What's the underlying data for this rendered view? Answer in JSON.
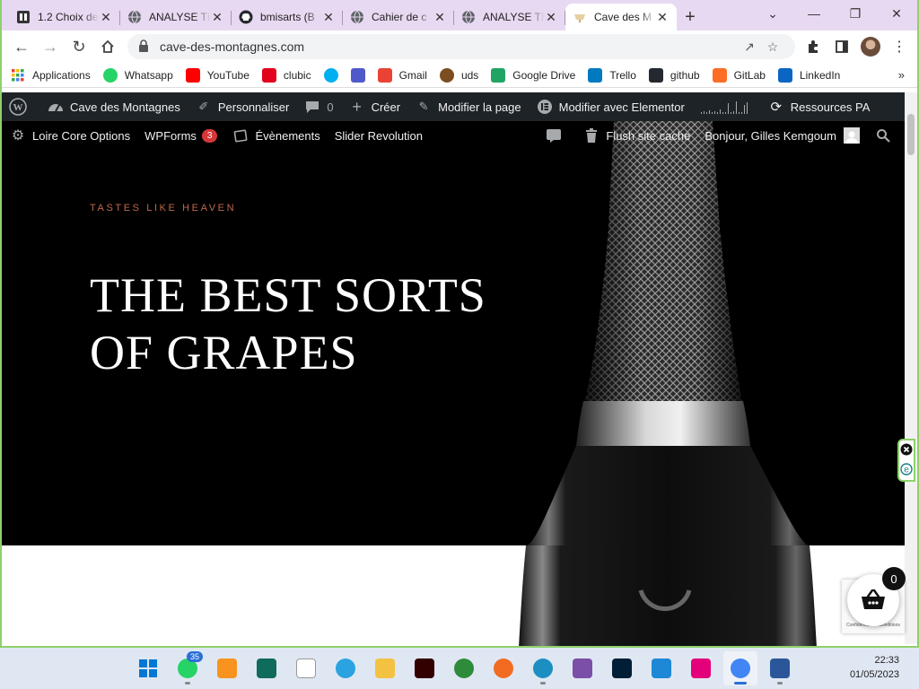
{
  "browser": {
    "tabs": [
      {
        "title": "1.2 Choix de",
        "icon": "document-icon",
        "active": false
      },
      {
        "title": "ANALYSE TE",
        "icon": "globe-icon",
        "active": false
      },
      {
        "title": "bmisarts (B",
        "icon": "github-icon",
        "active": false
      },
      {
        "title": "Cahier de c",
        "icon": "globe-icon",
        "active": false
      },
      {
        "title": "ANALYSE TE",
        "icon": "globe-icon",
        "active": false
      },
      {
        "title": "Cave des M",
        "icon": "wine-icon",
        "active": true
      }
    ],
    "new_tab": "+",
    "url": "cave-des-montagnes.com",
    "bookmarks": [
      {
        "label": "Applications",
        "icon": "apps-grid-icon",
        "color": "#ea4335"
      },
      {
        "label": "Whatsapp",
        "icon": "whatsapp-icon",
        "color": "#25d366"
      },
      {
        "label": "YouTube",
        "icon": "youtube-icon",
        "color": "#ff0000"
      },
      {
        "label": "clubic",
        "icon": "clubic-icon",
        "color": "#e3001b"
      },
      {
        "label": "",
        "icon": "skype-icon",
        "color": "#00aff0"
      },
      {
        "label": "",
        "icon": "teams-icon",
        "color": "#5059c9"
      },
      {
        "label": "Gmail",
        "icon": "gmail-icon",
        "color": "#ea4335"
      },
      {
        "label": "uds",
        "icon": "uds-icon",
        "color": "#7b4d1f"
      },
      {
        "label": "Google Drive",
        "icon": "google-drive-icon",
        "color": "#1fa463"
      },
      {
        "label": "Trello",
        "icon": "trello-icon",
        "color": "#0079bf"
      },
      {
        "label": "github",
        "icon": "github-icon",
        "color": "#24292f"
      },
      {
        "label": "GitLab",
        "icon": "gitlab-icon",
        "color": "#fc6d26"
      },
      {
        "label": "LinkedIn",
        "icon": "linkedin-icon",
        "color": "#0a66c2"
      }
    ],
    "more_bookmarks": "»"
  },
  "adminbar": {
    "site_name": "Cave des Montagnes",
    "customize": "Personnaliser",
    "comments": "0",
    "create": "Créer",
    "edit_page": "Modifier la page",
    "edit_elementor": "Modifier avec Elementor",
    "resources": "Ressources PA"
  },
  "subbar": {
    "loire_core": "Loire Core Options",
    "wpforms": "WPForms",
    "wpforms_badge": "3",
    "events": "Évènements",
    "slider": "Slider Revolution",
    "flush": "Flush site cache",
    "greeting": "Bonjour, Gilles Kemgoum"
  },
  "hero": {
    "kicker": "TASTES LIKE HEAVEN",
    "headline_line1": "THE BEST SORTS",
    "headline_line2": "OF GRAPES"
  },
  "cart": {
    "count": "0"
  },
  "recaptcha": {
    "text": "Confidentialité - Conditions"
  },
  "taskbar": {
    "apps": [
      {
        "icon": "windows-start-icon",
        "color": "#0078d4"
      },
      {
        "icon": "whatsapp-icon",
        "color": "#25d366",
        "badge": "35"
      },
      {
        "icon": "fl-studio-icon",
        "color": "#f7931e"
      },
      {
        "icon": "terminal-icon",
        "color": "#0f6b5c"
      },
      {
        "icon": "file-icon",
        "color": "#ffffff"
      },
      {
        "icon": "telegram-icon",
        "color": "#2aa3e0"
      },
      {
        "icon": "file-explorer-icon",
        "color": "#f4c242"
      },
      {
        "icon": "illustrator-icon",
        "color": "#330000"
      },
      {
        "icon": "globe-app-icon",
        "color": "#2e8b3a"
      },
      {
        "icon": "brave-icon",
        "color": "#f36b21"
      },
      {
        "icon": "edge-icon",
        "color": "#1d8ec2"
      },
      {
        "icon": "visual-studio-icon",
        "color": "#7b4ea8"
      },
      {
        "icon": "photoshop-icon",
        "color": "#001e36"
      },
      {
        "icon": "vscode-icon",
        "color": "#1e88d6"
      },
      {
        "icon": "wamp-icon",
        "color": "#e3007a"
      },
      {
        "icon": "chrome-icon",
        "color": "#4285f4",
        "active": true
      },
      {
        "icon": "word-icon",
        "color": "#2b579a"
      }
    ],
    "time": "22:33",
    "date": "01/05/2023"
  }
}
